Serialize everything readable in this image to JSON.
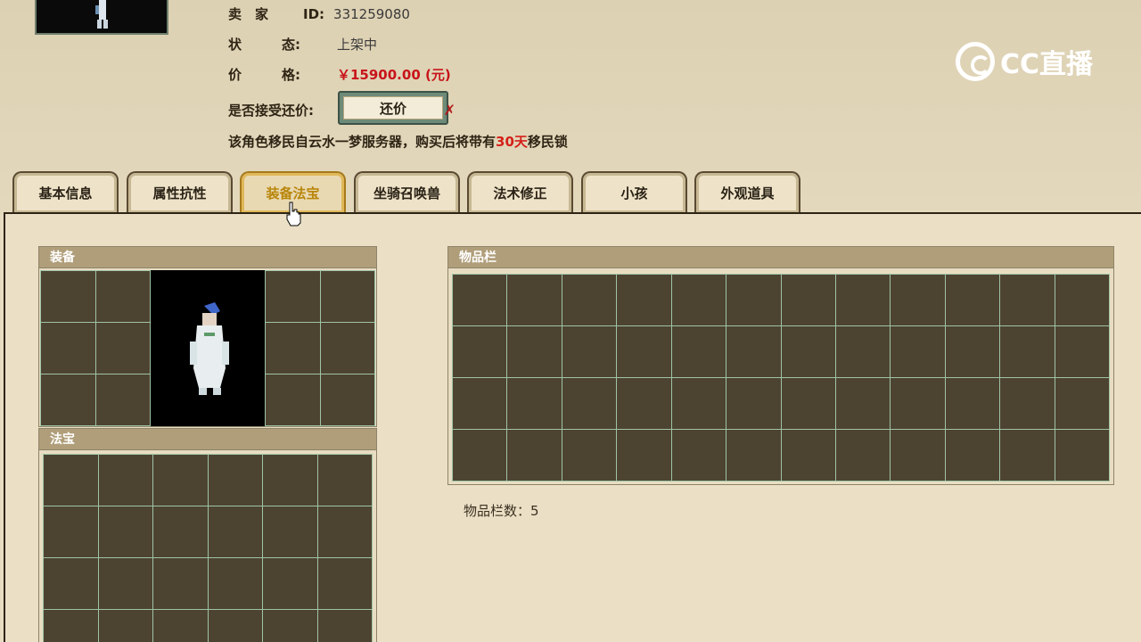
{
  "seller": {
    "label": "卖　家",
    "id_label": "ID:",
    "id_value": "331259080"
  },
  "status": {
    "label": "状　　　态:",
    "value": "上架中"
  },
  "price": {
    "label": "价　　　格:",
    "value": "￥15900.00 (元)"
  },
  "offer": {
    "label": "是否接受还价:",
    "button_label": "还价"
  },
  "migrate": {
    "prefix": "该角色移民自云水一梦服务器，购买后将带有",
    "days": "30天",
    "suffix": "移民锁"
  },
  "logo": {
    "text": "CC直播"
  },
  "tabs": [
    {
      "label": "基本信息"
    },
    {
      "label": "属性抗性"
    },
    {
      "label": "装备法宝"
    },
    {
      "label": "坐骑召唤兽"
    },
    {
      "label": "法术修正"
    },
    {
      "label": "小孩"
    },
    {
      "label": "外观道具"
    }
  ],
  "active_tab": "装备法宝",
  "equipment": {
    "title": "装备"
  },
  "fabao": {
    "title": "法宝"
  },
  "inventory": {
    "title": "物品栏",
    "count_label": "物品栏数：5"
  },
  "colors": {
    "accent_price": "#c8141a",
    "cell": "#4d4331",
    "grid_line": "#9fc4a6",
    "header": "#b09e7a"
  }
}
